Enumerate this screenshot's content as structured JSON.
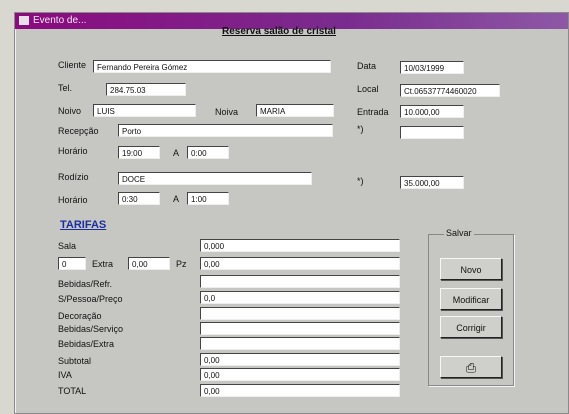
{
  "window": {
    "title": "Evento de..."
  },
  "form": {
    "heading": "Reserva salão de cristal",
    "labels": {
      "cliente": "Cliente",
      "data": "Data",
      "tel": "Tel.",
      "local": "Local",
      "noivo": "Noivo",
      "noiva": "Noiva",
      "entrada": "Entrada",
      "recepcao": "Recepção",
      "horario1": "Horário",
      "horario1_a": "A",
      "rodizio": "Rodízio",
      "horario2": "Horário",
      "horario2_a": "A",
      "star1": "*)",
      "star2": "*)"
    },
    "values": {
      "cliente": "Fernando Pereira Gómez",
      "data": "10/03/1999",
      "tel": "284.75.03",
      "local": "Ct.06537774460020",
      "noivo": "LUIS",
      "noiva": "MARIA",
      "entrada": "10.000,00",
      "star1": "",
      "recepcao": "Porto",
      "horario1_from": "19:00",
      "horario1_to": "0:00",
      "rodizio": "DOCE",
      "horario2_from": "0:30",
      "horario2_to": "1:00",
      "star2": "35.000,00"
    }
  },
  "tarifas": {
    "title": "TARIFAS",
    "rows": [
      {
        "label": "Sala",
        "value": "0,000"
      },
      {
        "label": "Extra",
        "value": "0,00"
      },
      {
        "label": "Bebidas/Refr.",
        "value": ""
      },
      {
        "label": "S/Pessoa/Preço",
        "value": "0,0"
      },
      {
        "label": "Decoração",
        "value": ""
      },
      {
        "label": "Bebidas/Serviço",
        "value": ""
      },
      {
        "label": "Bebidas/Extra",
        "value": ""
      },
      {
        "label": "Subtotal",
        "value": "0,00"
      },
      {
        "label": "IVA",
        "value": "0,00"
      },
      {
        "label": "TOTAL",
        "value": "0,00"
      }
    ],
    "extra": {
      "qty": "0",
      "qty_label": "Extra",
      "price": "0,00",
      "unit": "Pz"
    }
  },
  "actions": {
    "group_label": "Salvar",
    "buttons": [
      "Novo",
      "Modificar",
      "Corrigir"
    ],
    "print_icon": "printer-icon"
  }
}
